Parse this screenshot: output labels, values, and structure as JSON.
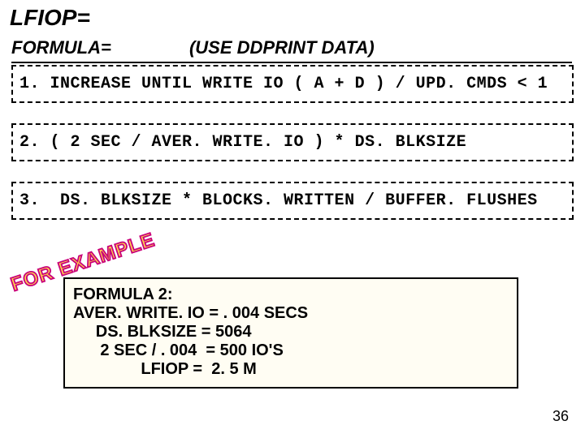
{
  "title": "LFIOP=",
  "subheader": {
    "label": "FORMULA=",
    "note": "(USE DDPRINT DATA)"
  },
  "formulas": [
    "1. INCREASE UNTIL WRITE IO ( A + D ) / UPD. CMDS < 1",
    "2. ( 2 SEC / AVER. WRITE. IO ) * DS. BLKSIZE",
    "3.  DS. BLKSIZE * BLOCKS. WRITTEN / BUFFER. FLUSHES"
  ],
  "example": {
    "stamp": "FOR EXAMPLE",
    "title": "FORMULA 2:",
    "lines": [
      "AVER. WRITE. IO = . 004 SECS",
      "     DS. BLKSIZE = 5064",
      "      2 SEC / . 004  = 500 IO'S",
      "               LFIOP =  2. 5 M"
    ]
  },
  "page_number": "36"
}
